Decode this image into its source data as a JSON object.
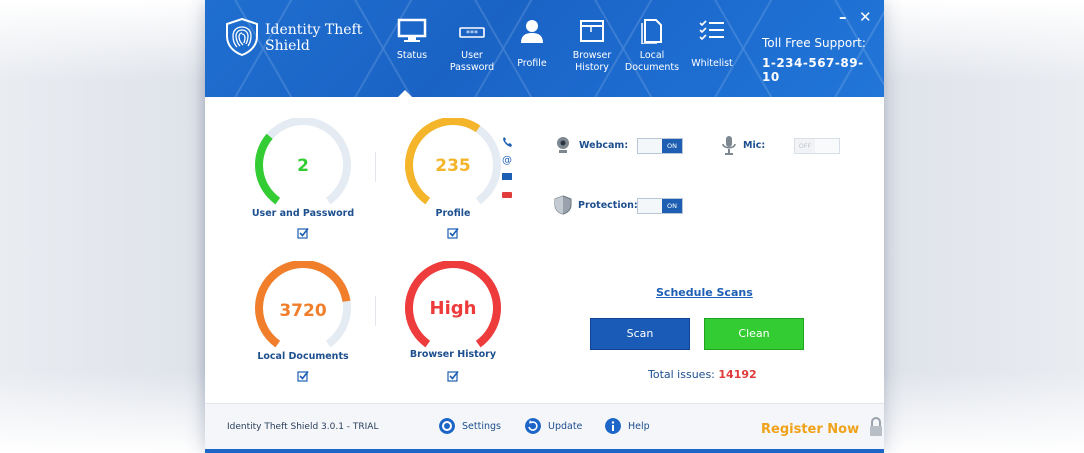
{
  "app": {
    "name": "Identity Theft Shield"
  },
  "nav": [
    {
      "label": "Status",
      "icon": "monitor-icon"
    },
    {
      "label": "User\nPassword",
      "icon": "password-icon"
    },
    {
      "label": "Profile",
      "icon": "person-icon"
    },
    {
      "label": "Browser\nHistory",
      "icon": "browser-window-icon"
    },
    {
      "label": "Local\nDocuments",
      "icon": "documents-icon"
    },
    {
      "label": "Whitelist",
      "icon": "checklist-icon"
    }
  ],
  "window_controls": {
    "minimize": "–",
    "close": "✕"
  },
  "support": {
    "title": "Toll Free Support:",
    "phone": "1-234-567-89-10"
  },
  "gauges": [
    {
      "value": "2",
      "label": "User and Password",
      "color": "#33cc33",
      "fill": 0.33
    },
    {
      "value": "235",
      "label": "Profile",
      "color": "#f5b52a",
      "fill": 0.62
    },
    {
      "value": "3720",
      "label": "Local Documents",
      "color": "#f07e2a",
      "fill": 0.78
    },
    {
      "value": "High",
      "label": "Browser History",
      "color": "#ee3b3b",
      "fill": 1.0
    }
  ],
  "toggles": {
    "webcam": {
      "label": "Webcam:",
      "state": "ON"
    },
    "mic": {
      "label": "Mic:",
      "state": "OFF"
    },
    "protection": {
      "label": "Protection:",
      "state": "ON"
    }
  },
  "schedule_label": "Schedule Scans",
  "buttons": {
    "scan": "Scan",
    "clean": "Clean"
  },
  "total": {
    "label": "Total issues:",
    "value": "14192"
  },
  "footer": {
    "version": "Identity Theft Shield 3.0.1 - TRIAL",
    "settings": "Settings",
    "update": "Update",
    "help": "Help",
    "register": "Register Now"
  }
}
